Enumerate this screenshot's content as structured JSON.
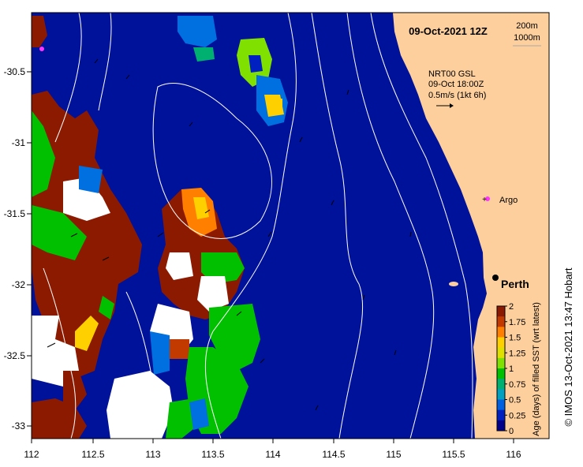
{
  "header": {
    "datetime": "09-Oct-2021 12Z",
    "depth_legend": [
      "200m",
      "1000m"
    ]
  },
  "vector_note": {
    "line1": "NRT00 GSL",
    "line2": "09-Oct 18:00Z",
    "line3": "0.5m/s (1kt 6h)"
  },
  "places": {
    "argo": "Argo",
    "perth": "Perth"
  },
  "axes": {
    "x_ticks": [
      "112",
      "112.5",
      "113",
      "113.5",
      "114",
      "114.5",
      "115",
      "115.5",
      "116"
    ],
    "y_ticks": [
      "-30.5",
      "-31",
      "-31.5",
      "-32",
      "-32.5",
      "-33"
    ]
  },
  "colorbar": {
    "label": "Age (days) of filled SST (wrt latest)",
    "ticks": [
      "2",
      "1.75",
      "1.5",
      "1.25",
      "1",
      "0.75",
      "0.5",
      "0.25",
      "0"
    ],
    "colors": [
      "#8b1a00",
      "#c23a00",
      "#ff7f00",
      "#ffd000",
      "#e0e000",
      "#80e000",
      "#00c000",
      "#00b070",
      "#00a0c0",
      "#0060e0",
      "#0020c0",
      "#00008b"
    ]
  },
  "credit": "© IMOS 13-Oct-2021 13:47 Hobart",
  "colors": {
    "ocean": "#00129a",
    "land": "#fdcf9d",
    "isobath": "#ffffff",
    "argo_marker": "#ff33ff"
  }
}
